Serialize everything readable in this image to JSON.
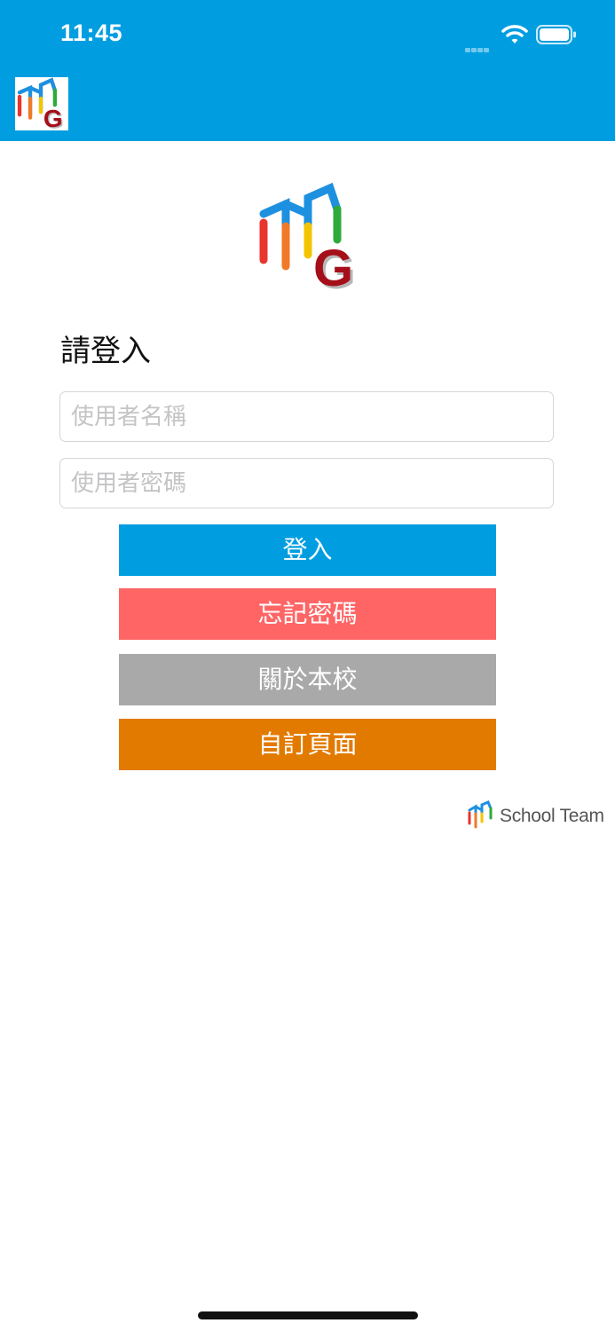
{
  "status_bar": {
    "time": "11:45"
  },
  "colors": {
    "brand_blue": "#009ee0",
    "forgot_red": "#ff6565",
    "about_gray": "#a9a9a9",
    "custom_orange": "#e37a00"
  },
  "login": {
    "heading": "請登入",
    "username_placeholder": "使用者名稱",
    "password_placeholder": "使用者密碼",
    "login_label": "登入",
    "forgot_label": "忘記密碼",
    "about_label": "關於本校",
    "custom_label": "自訂頁面"
  },
  "footer": {
    "brand_text": "School Team"
  },
  "icons": [
    "app-logo-icon",
    "wifi-icon",
    "battery-icon",
    "signal-icon",
    "school-team-logo-icon"
  ]
}
